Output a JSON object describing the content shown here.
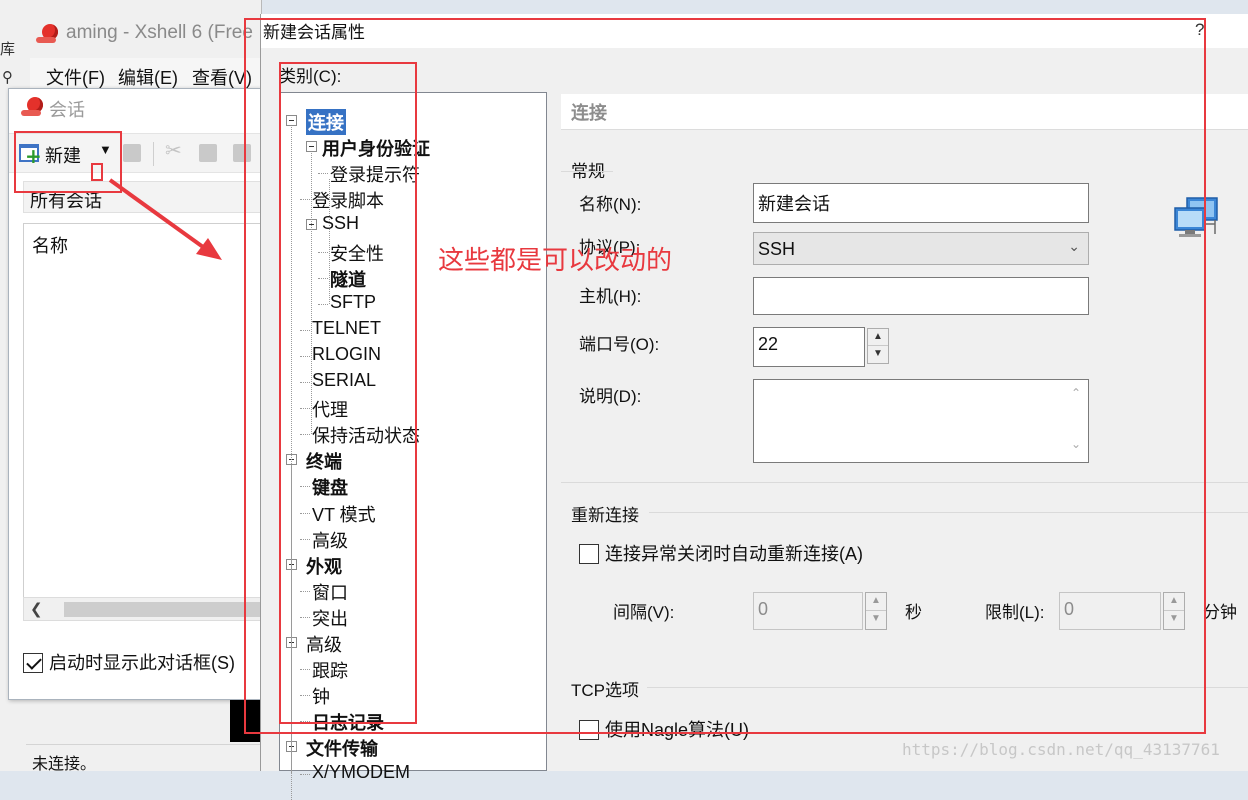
{
  "xshell": {
    "title": "aming - Xshell 6 (Free",
    "left_tab_label": "库",
    "menu": [
      "文件(F)",
      "编辑(E)",
      "查看(V)"
    ],
    "status": "未连接。"
  },
  "session_dialog": {
    "title": "会话",
    "new_label": "新建",
    "all_sessions": "所有会话",
    "column_name": "名称",
    "startup_checkbox": "启动时显示此对话框(S)",
    "startup_checked": true
  },
  "main_dialog": {
    "title": "新建会话属性",
    "help": "?",
    "category_label": "类别(C):",
    "tree": [
      {
        "label": "连接",
        "level": 0,
        "bold": true,
        "selected": true,
        "expanded": true
      },
      {
        "label": "用户身份验证",
        "level": 1,
        "bold": true,
        "expanded": true
      },
      {
        "label": "登录提示符",
        "level": 2
      },
      {
        "label": "登录脚本",
        "level": 1
      },
      {
        "label": "SSH",
        "level": 1,
        "expanded": true
      },
      {
        "label": "安全性",
        "level": 2
      },
      {
        "label": "隧道",
        "level": 2,
        "bold": true
      },
      {
        "label": "SFTP",
        "level": 2
      },
      {
        "label": "TELNET",
        "level": 1
      },
      {
        "label": "RLOGIN",
        "level": 1
      },
      {
        "label": "SERIAL",
        "level": 1
      },
      {
        "label": "代理",
        "level": 1
      },
      {
        "label": "保持活动状态",
        "level": 1
      },
      {
        "label": "终端",
        "level": 0,
        "bold": true,
        "expanded": true
      },
      {
        "label": "键盘",
        "level": 1,
        "bold": true
      },
      {
        "label": "VT 模式",
        "level": 1
      },
      {
        "label": "高级",
        "level": 1
      },
      {
        "label": "外观",
        "level": 0,
        "bold": true,
        "expanded": true
      },
      {
        "label": "窗口",
        "level": 1
      },
      {
        "label": "突出",
        "level": 1
      },
      {
        "label": "高级",
        "level": 0,
        "expanded": true
      },
      {
        "label": "跟踪",
        "level": 1
      },
      {
        "label": "钟",
        "level": 1
      },
      {
        "label": "日志记录",
        "level": 1,
        "bold": true
      },
      {
        "label": "文件传输",
        "level": 0,
        "bold": true,
        "expanded": true
      },
      {
        "label": "X/YMODEM",
        "level": 1
      }
    ],
    "panel_title": "连接",
    "general_group": "常规",
    "name_label": "名称(N):",
    "name_value": "新建会话",
    "protocol_label": "协议(P):",
    "protocol_value": "SSH",
    "host_label": "主机(H):",
    "host_value": "",
    "port_label": "端口号(O):",
    "port_value": "22",
    "desc_label": "说明(D):",
    "desc_value": "",
    "reconnect_group": "重新连接",
    "reconnect_checkbox": "连接异常关闭时自动重新连接(A)",
    "reconnect_checked": false,
    "interval_label": "间隔(V):",
    "interval_value": "0",
    "interval_unit": "秒",
    "limit_label": "限制(L):",
    "limit_value": "0",
    "limit_unit": "分钟",
    "tcp_group": "TCP选项",
    "nagle_checkbox": "使用Nagle算法(U)",
    "nagle_checked": false
  },
  "annotation": {
    "note": "这些都是可以改动的",
    "color": "#e8393f"
  },
  "watermark": "https://blog.csdn.net/qq_43137761"
}
